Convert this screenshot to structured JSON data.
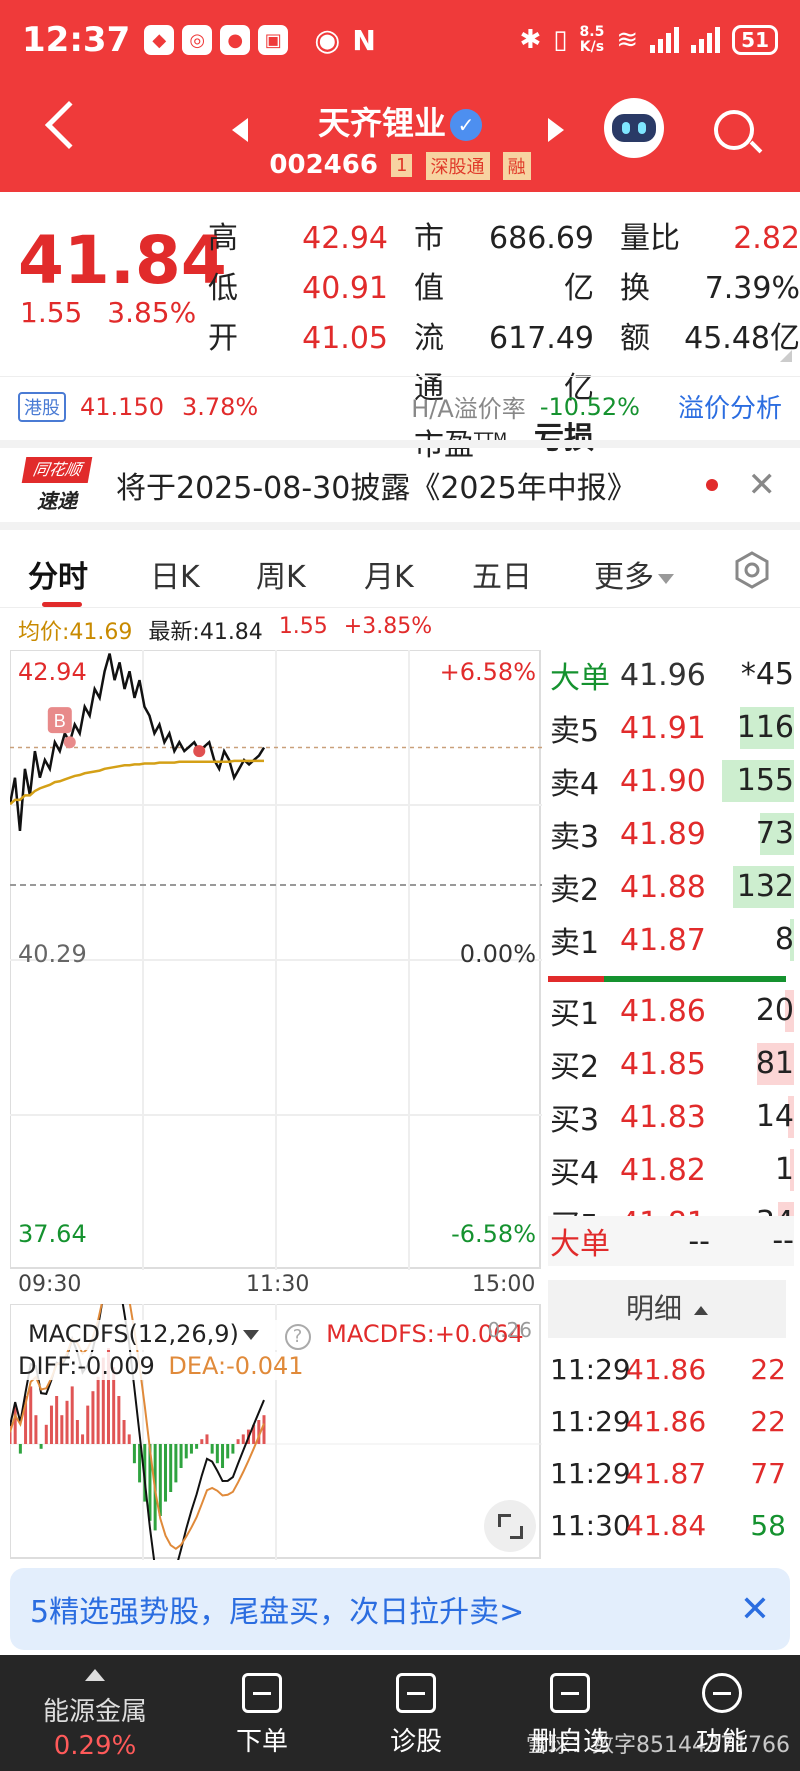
{
  "status_bar": {
    "time": "12:37",
    "net_speed_top": "8.5",
    "net_speed_bottom": "K/s",
    "battery": "51"
  },
  "nav": {
    "title": "天齐锂业",
    "code": "002466",
    "tag_num": "1",
    "tag_connect": "深股通",
    "tag_margin": "融"
  },
  "quote": {
    "price": "41.84",
    "change": "1.55",
    "change_pct": "3.85%",
    "rows": [
      {
        "l1": "高",
        "v1": "42.94",
        "l2": "市值",
        "v2": "686.69亿",
        "l3": "量比",
        "v3": "2.82"
      },
      {
        "l1": "低",
        "v1": "40.91",
        "l2": "流通",
        "v2": "617.49亿",
        "l3": "换",
        "v3": "7.39%"
      },
      {
        "l1": "开",
        "v1": "41.05",
        "l2": "市盈",
        "note": "TTM",
        "v2": "亏损",
        "l3": "额",
        "v3": "45.48亿"
      }
    ]
  },
  "hshare": {
    "tag": "港股",
    "price": "41.150",
    "pct": "3.78%",
    "ha_label": "H/A溢价率",
    "ha_value": "-10.52%",
    "link": "溢价分析"
  },
  "notice": {
    "logo_top": "同花顺",
    "logo_bottom": "速递",
    "text": "将于2025-08-30披露《2025年中报》"
  },
  "tabs": [
    "分时",
    "日K",
    "周K",
    "月K",
    "五日",
    "更多"
  ],
  "info_line": {
    "avg": "均价:41.69",
    "latest": "最新:41.84",
    "change": "1.55",
    "pct": "+3.85%"
  },
  "chart_data": {
    "type": "line",
    "title": "",
    "y_left_ticks": [
      "42.94",
      "40.29",
      "37.64"
    ],
    "y_right_ticks": [
      "+6.58%",
      "0.00%",
      "-6.58%"
    ],
    "x_ticks": [
      "09:30",
      "11:30",
      "15:00"
    ],
    "ylim": [
      37.64,
      42.94
    ],
    "prev_close": 40.29,
    "latest": 41.84,
    "series": [
      {
        "values": [
          41.2,
          41.5,
          40.9,
          41.6,
          41.3,
          41.8,
          41.5,
          41.7,
          41.6,
          41.9,
          41.8,
          42.0,
          41.9,
          42.1,
          42.0,
          42.3,
          42.2,
          42.5,
          42.4,
          42.7,
          42.9,
          42.6,
          42.8,
          42.5,
          42.7,
          42.4,
          42.6,
          42.3,
          42.2,
          42.0,
          42.1,
          41.9,
          42.0,
          41.8,
          41.9,
          41.8,
          41.85,
          41.9,
          41.8,
          41.85,
          41.9,
          41.7,
          41.6,
          41.8,
          41.7,
          41.5,
          41.6,
          41.7,
          41.65,
          41.7,
          41.75,
          41.84
        ]
      },
      {
        "values": [
          41.2,
          41.25,
          41.25,
          41.3,
          41.3,
          41.35,
          41.38,
          41.4,
          41.42,
          41.45,
          41.46,
          41.48,
          41.5,
          41.52,
          41.53,
          41.55,
          41.56,
          41.57,
          41.58,
          41.6,
          41.61,
          41.62,
          41.63,
          41.64,
          41.64,
          41.65,
          41.65,
          41.66,
          41.66,
          41.66,
          41.67,
          41.67,
          41.67,
          41.67,
          41.68,
          41.68,
          41.68,
          41.68,
          41.68,
          41.68,
          41.68,
          41.68,
          41.68,
          41.68,
          41.68,
          41.69,
          41.69,
          41.69,
          41.69,
          41.69,
          41.69,
          41.69
        ]
      }
    ],
    "buy_marker": "B"
  },
  "macd": {
    "title": "MACDFS(12,26,9)",
    "help": "?",
    "value": "MACDFS:+0.064",
    "diff": "DIFF:-0.009",
    "dea": "DEA:-0.041",
    "axis_label": "0.26",
    "bars": [
      0.05,
      0.08,
      -0.02,
      0.1,
      0.12,
      0.06,
      -0.01,
      0.04,
      0.08,
      0.1,
      0.06,
      0.09,
      0.12,
      0.05,
      0.02,
      0.08,
      0.11,
      0.14,
      0.18,
      0.2,
      0.16,
      0.1,
      0.05,
      0.02,
      -0.04,
      -0.08,
      -0.12,
      -0.16,
      -0.18,
      -0.15,
      -0.12,
      -0.1,
      -0.08,
      -0.05,
      -0.03,
      -0.02,
      -0.01,
      0.01,
      0.02,
      -0.02,
      -0.04,
      -0.05,
      -0.03,
      -0.02,
      0.01,
      0.02,
      0.03,
      0.04,
      0.05,
      0.06
    ]
  },
  "orderbook": {
    "big_label": "大单",
    "big_price": "41.96",
    "big_vol": "*45",
    "sells": [
      {
        "label": "卖5",
        "price": "41.91",
        "vol": "116",
        "fill": 0.75
      },
      {
        "label": "卖4",
        "price": "41.90",
        "vol": "155",
        "fill": 1.0
      },
      {
        "label": "卖3",
        "price": "41.89",
        "vol": "73",
        "fill": 0.47
      },
      {
        "label": "卖2",
        "price": "41.88",
        "vol": "132",
        "fill": 0.85
      },
      {
        "label": "卖1",
        "price": "41.87",
        "vol": "8",
        "fill": 0.05
      }
    ],
    "buys": [
      {
        "label": "买1",
        "price": "41.86",
        "vol": "20",
        "fill": 0.13
      },
      {
        "label": "买2",
        "price": "41.85",
        "vol": "81",
        "fill": 0.52
      },
      {
        "label": "买3",
        "price": "41.83",
        "vol": "14",
        "fill": 0.09
      },
      {
        "label": "买4",
        "price": "41.82",
        "vol": "1",
        "fill": 0.0
      },
      {
        "label": "买5",
        "price": "41.81",
        "vol": "34",
        "fill": 0.22
      }
    ],
    "big2_label": "大单",
    "big2_price": "--",
    "big2_vol": "--"
  },
  "detail": {
    "title": "明细",
    "trades": [
      {
        "time": "11:29",
        "price": "41.86",
        "vol": "22",
        "dir": "up"
      },
      {
        "time": "11:29",
        "price": "41.86",
        "vol": "22",
        "dir": "up"
      },
      {
        "time": "11:29",
        "price": "41.87",
        "vol": "77",
        "dir": "up"
      },
      {
        "time": "11:30",
        "price": "41.84",
        "vol": "58",
        "dir": "down"
      }
    ]
  },
  "banner": {
    "text": "5精选强势股，尾盘买，次日拉升卖>"
  },
  "bottom_nav": {
    "sector_name": "能源金属",
    "sector_pct": "0.29%",
    "items": [
      "下单",
      "诊股",
      "删自选",
      "功能"
    ],
    "watermark": "雪球：数字85144371766"
  },
  "colors": {
    "header_red": "#ef3a3a",
    "up": "#e12b2b",
    "down": "#15922f",
    "avg_line": "#c88a00"
  }
}
